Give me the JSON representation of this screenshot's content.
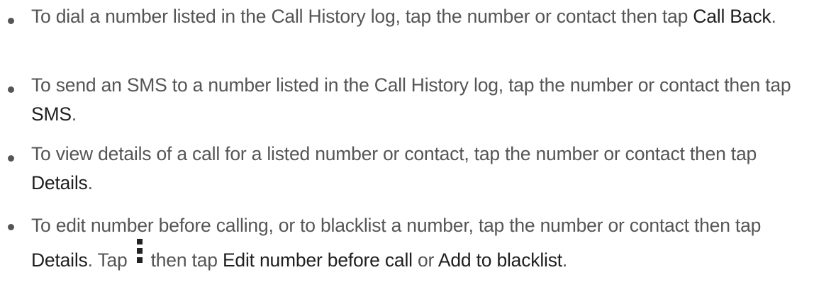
{
  "items": [
    {
      "pre": "To dial a number listed in the Call History log, tap the number or contact then tap ",
      "ui": "Call Back",
      "post": "."
    },
    {
      "pre": "To send an SMS to a number listed in the Call History log, tap the number or contact then tap ",
      "ui": "SMS",
      "post": "."
    },
    {
      "pre": "To view details of a call for a listed number or contact, tap the number or contact then tap ",
      "ui": "Details",
      "post": "."
    },
    {
      "pre": "To edit number before calling, or to blacklist a number, tap the number or contact then tap ",
      "ui": "Details",
      "mid1": ". Tap",
      "icon": "more-vertical-icon",
      "mid2": "then tap ",
      "ui2": "Edit number before call",
      "mid3": " or ",
      "ui3": "Add to blacklist",
      "post": "."
    }
  ]
}
